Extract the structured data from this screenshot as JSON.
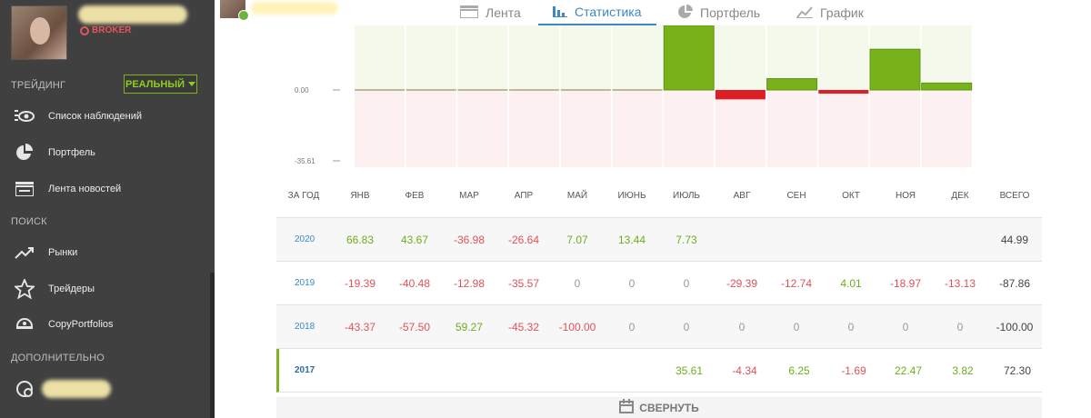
{
  "sidebar": {
    "broker_label": "BROKER",
    "trading_title": "ТРЕЙДИНГ",
    "mode_value": "РЕАЛЬНЫЙ",
    "search_title": "ПОИСК",
    "extra_title": "ДОПОЛНИТЕЛЬНО",
    "items": [
      {
        "label": "Список наблюдений",
        "icon": "eye-icon"
      },
      {
        "label": "Портфель",
        "icon": "pie-chart-icon"
      },
      {
        "label": "Лента новостей",
        "icon": "news-feed-icon"
      },
      {
        "label": "Рынки",
        "icon": "trend-icon"
      },
      {
        "label": "Трейдеры",
        "icon": "star-icon"
      },
      {
        "label": "CopyPortfolios",
        "icon": "copyportfolio-icon"
      }
    ]
  },
  "tabs": [
    {
      "label": "Лента",
      "icon": "feed-icon"
    },
    {
      "label": "Статистика",
      "icon": "bar-chart-icon",
      "active": true
    },
    {
      "label": "Портфель",
      "icon": "pie-chart-icon"
    },
    {
      "label": "График",
      "icon": "line-chart-icon"
    }
  ],
  "colors": {
    "positive": "#6cae1e",
    "negative": "#e05257",
    "accent": "#3e89c3",
    "bar_positive": "#77b21a",
    "bar_negative": "#dc1e26"
  },
  "chart_data": {
    "type": "bar",
    "categories": [
      "ЯНВ",
      "ФЕВ",
      "МАР",
      "АПР",
      "МАЙ",
      "ИЮНЬ",
      "ИЮЛЬ",
      "АВГ",
      "СЕН",
      "ОКТ",
      "НОЯ",
      "ДЕК"
    ],
    "values": [
      0,
      0,
      0,
      0,
      0,
      0,
      35.61,
      -4.34,
      6.25,
      -1.69,
      22.47,
      3.82
    ],
    "y_tick_labels": [
      "0.00",
      "-35.61"
    ],
    "ylim": [
      -35.61,
      35.61
    ],
    "grid": false
  },
  "table": {
    "headers": [
      "ЗА ГОД",
      "ЯНВ",
      "ФЕВ",
      "МАР",
      "АПР",
      "МАЙ",
      "ИЮНЬ",
      "ИЮЛЬ",
      "АВГ",
      "СЕН",
      "ОКТ",
      "НОЯ",
      "ДЕК",
      "ВСЕГО"
    ],
    "rows": [
      {
        "year": "2020",
        "cells": [
          "66.83",
          "43.67",
          "-36.98",
          "-26.64",
          "7.07",
          "13.44",
          "7.73",
          "",
          "",
          "",
          "",
          ""
        ],
        "total": "44.99"
      },
      {
        "year": "2019",
        "cells": [
          "-19.39",
          "-40.48",
          "-12.98",
          "-35.57",
          "0",
          "0",
          "0",
          "-29.39",
          "-12.74",
          "4.01",
          "-18.97",
          "-13.13"
        ],
        "total": "-87.86"
      },
      {
        "year": "2018",
        "cells": [
          "-43.37",
          "-57.50",
          "59.27",
          "-45.32",
          "-100.00",
          "0",
          "0",
          "0",
          "0",
          "0",
          "0",
          "0"
        ],
        "total": "-100.00"
      },
      {
        "year": "2017",
        "cells": [
          "",
          "",
          "",
          "",
          "",
          "",
          "35.61",
          "-4.34",
          "6.25",
          "-1.69",
          "22.47",
          "3.82"
        ],
        "total": "72.30",
        "selected": true
      }
    ]
  },
  "collapse_label": "СВЕРНУТЬ"
}
